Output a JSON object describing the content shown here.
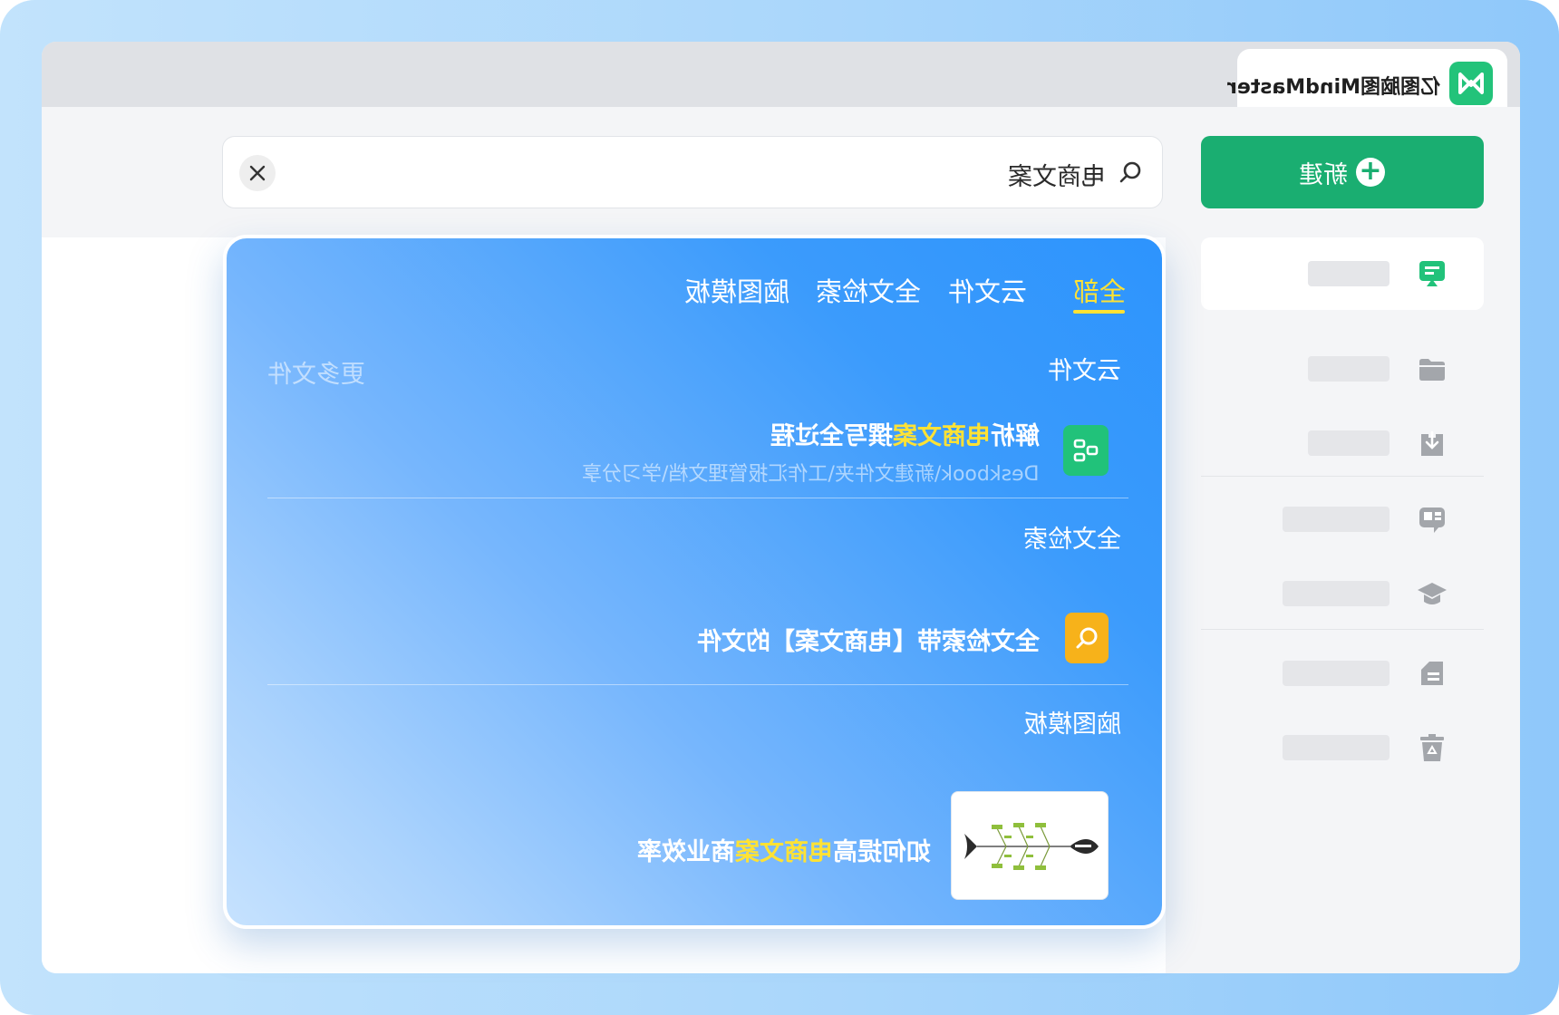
{
  "app": {
    "title": "亿图脑图MindMaster",
    "logo_icon": "mindmaster-logo-icon"
  },
  "toolbar": {
    "new_label": "新建",
    "new_icon": "plus-circle-icon"
  },
  "search": {
    "query": "电商文案",
    "clear_icon": "close-icon",
    "search_icon": "search-icon"
  },
  "sidebar": {
    "items": [
      {
        "icon": "recent-files-icon",
        "active": true
      },
      {
        "icon": "folder-icon"
      },
      {
        "icon": "download-icon"
      },
      {
        "icon": "message-icon"
      },
      {
        "icon": "graduation-cap-icon"
      },
      {
        "icon": "document-icon"
      },
      {
        "icon": "recycle-bin-icon"
      }
    ]
  },
  "results": {
    "tabs": [
      {
        "label": "全部",
        "active": true
      },
      {
        "label": "云文件"
      },
      {
        "label": "全文检索"
      },
      {
        "label": "脑图模板"
      }
    ],
    "cloud_files": {
      "title": "云文件",
      "more_label": "更多文件",
      "item": {
        "title_pre": "解析",
        "title_hl": "电商文案",
        "title_post": "撰写全过程",
        "path": "Deskbook\\新建文件夹\\工作汇报管理文档\\学习分享",
        "icon": "mindmap-file-icon"
      }
    },
    "fulltext": {
      "title": "全文检索",
      "item_text": "全文检索带【电商文案】的文件",
      "icon": "search-icon"
    },
    "templates": {
      "title": "脑图模板",
      "item": {
        "title_pre": "如何提高",
        "title_hl": "电商文案",
        "title_post": "商业效率",
        "thumbnail": "fishbone-diagram-thumbnail"
      }
    }
  },
  "colors": {
    "brand_green": "#1aae71",
    "highlight_yellow": "#ffe234",
    "panel_blue": "#2d94fd",
    "fulltext_orange": "#f7b21a"
  }
}
